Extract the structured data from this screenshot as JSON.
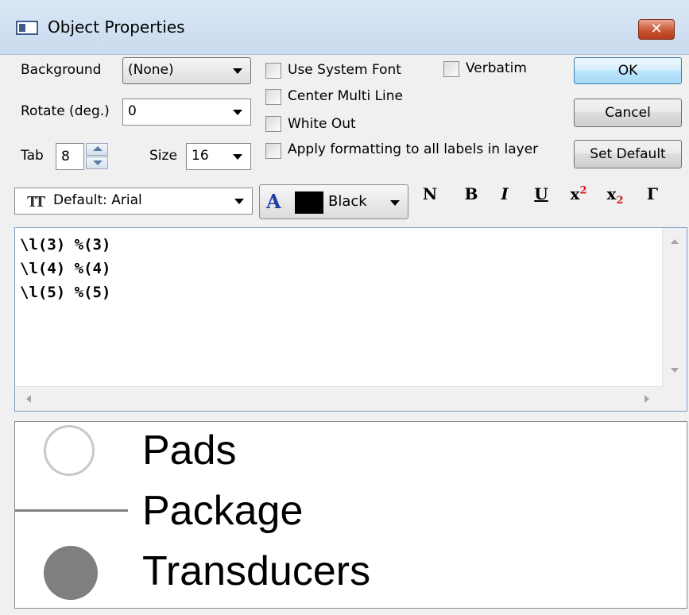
{
  "window": {
    "title": "Object Properties",
    "close_label": "✕"
  },
  "background": {
    "label": "Background",
    "value": "(None)"
  },
  "rotate": {
    "label": "Rotate (deg.)",
    "value": "0"
  },
  "tab": {
    "label": "Tab",
    "value": "8"
  },
  "size": {
    "label": "Size",
    "value": "16"
  },
  "checkboxes": {
    "use_system_font": "Use System Font",
    "verbatim": "Verbatim",
    "center_multi_line": "Center Multi Line",
    "white_out": "White Out",
    "apply_formatting": "Apply formatting to all labels in layer"
  },
  "buttons": {
    "ok": "OK",
    "cancel": "Cancel",
    "set_default": "Set Default"
  },
  "font": {
    "icon": "TT",
    "value": "Default: Arial"
  },
  "color": {
    "letter": "A",
    "value": "Black",
    "swatch": "#000000"
  },
  "format": {
    "normal": "N",
    "bold": "B",
    "italic": "I",
    "underline": "U",
    "superscript_base": "x",
    "superscript_mark": "2",
    "subscript_base": "x",
    "subscript_mark": "2",
    "greek": "Γ"
  },
  "editor": {
    "text": "\\l(3) %(3)\n\\l(4) %(4)\n\\l(5) %(5)"
  },
  "preview": {
    "items": [
      {
        "label": "Pads",
        "symbol": "hollow-circle"
      },
      {
        "label": "Package",
        "symbol": "line"
      },
      {
        "label": "Transducers",
        "symbol": "filled-circle"
      }
    ]
  },
  "colors": {
    "accent": "#3c7fb1",
    "close": "#c7512e",
    "symbol_gray": "#7f7f7f",
    "superscript_red": "#d9141b"
  }
}
